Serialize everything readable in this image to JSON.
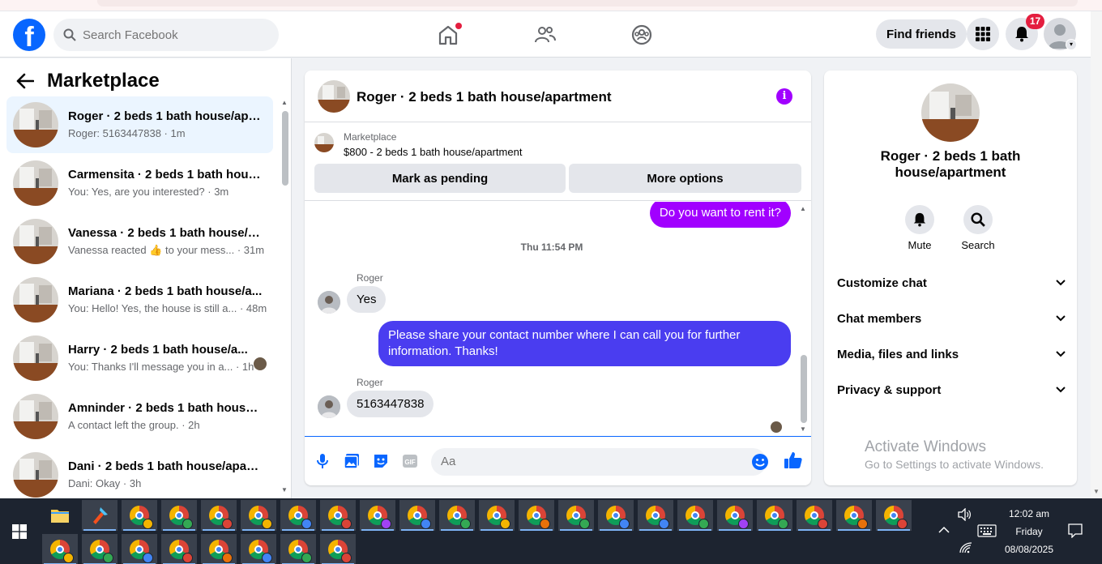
{
  "topnav": {
    "logo": "f",
    "search_placeholder": "Search Facebook",
    "find_friends": "Find friends",
    "notification_count": "17"
  },
  "sidebar": {
    "title": "Marketplace",
    "conversations": [
      {
        "name": "Roger · 2 beds 1 bath house/apa...",
        "sub": "Roger: 5163447838 · 1m",
        "active": true
      },
      {
        "name": "Carmensita · 2 beds 1 bath hous...",
        "sub": "You: Yes, are you interested? · 3m"
      },
      {
        "name": "Vanessa · 2 beds 1 bath house/a...",
        "sub": "Vanessa reacted 👍 to your mess... · 31m"
      },
      {
        "name": "Mariana · 2 beds 1 bath house/a...",
        "sub": "You: Hello! Yes, the house is still a... · 48m"
      },
      {
        "name": "Harry · 2 beds 1 bath house/a...",
        "sub": "You: Thanks I'll message you in a... · 1h"
      },
      {
        "name": "Amninder · 2 beds 1 bath house/...",
        "sub": "A contact left the group. · 2h"
      },
      {
        "name": "Dani · 2 beds 1 bath house/apart...",
        "sub": "Dani: Okay · 3h"
      }
    ]
  },
  "chat": {
    "title": "Roger · 2 beds 1 bath house/apartment",
    "info_icon": "i",
    "listing": {
      "category": "Marketplace",
      "price_title": "$800 - 2 beds 1 bath house/apartment",
      "mark_pending": "Mark as pending",
      "more_options": "More options"
    },
    "messages": {
      "out1": "Do you want to rent it?",
      "timestamp": "Thu 11:54 PM",
      "sender1": "Roger",
      "in1": "Yes",
      "out2": "Please share your contact number where I can call you for further information. Thanks!",
      "sender2": "Roger",
      "in2": "5163447838"
    },
    "composer_placeholder": "Aa"
  },
  "info_panel": {
    "title": "Roger · 2 beds 1 bath house/apartment",
    "mute": "Mute",
    "search": "Search",
    "rows": [
      "Customize chat",
      "Chat members",
      "Media, files and links",
      "Privacy & support"
    ]
  },
  "watermark": {
    "line1": "Activate Windows",
    "line2": "Go to Settings to activate Windows."
  },
  "taskbar": {
    "time": "12:02 am",
    "day": "Friday",
    "date": "08/08/2025"
  },
  "colors": {
    "brand": "#0866ff",
    "messenger_purple": "#a100ff",
    "outgoing_1": "#a100ff",
    "outgoing_2": "#4a3df0"
  }
}
